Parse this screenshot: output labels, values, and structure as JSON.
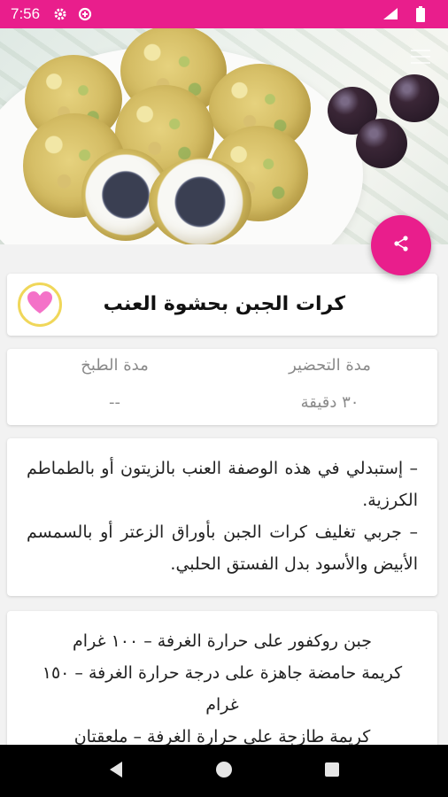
{
  "status_bar": {
    "time": "7:56",
    "background": "#e91e8c",
    "icons": [
      "gear-icon",
      "data-saver-icon",
      "wifi-icon",
      "battery-icon"
    ]
  },
  "recipe": {
    "title": "كرات الجبن بحشوة العنب",
    "prep_label": "مدة التحضير",
    "prep_value": "٣٠ دقيقة",
    "cook_label": "مدة الطبخ",
    "cook_value": "--",
    "tips": [
      "– إستبدلي في هذه الوصفة العنب بالزيتون أو بالطماطم الكرزية.",
      "– جربي تغليف كرات الجبن بأوراق الزعتر أو بالسمسم الأبيض والأسود بدل الفستق الحلبي."
    ],
    "ingredients": [
      "جبن روكفور على حرارة الغرفة – ١٠٠ غرام",
      "كريمة حامضة جاهزة على درجة حرارة الغرفة – ١٥٠ غرام",
      "كريمة طازجة على حرارة الغرفة – ملعقتان"
    ]
  },
  "actions": {
    "share_icon": "share-icon",
    "favorite_icon": "heart-icon",
    "accent": "#e91e8c",
    "heart_color": "#f472c8"
  },
  "nav": [
    "back-icon",
    "home-icon",
    "recents-icon"
  ]
}
